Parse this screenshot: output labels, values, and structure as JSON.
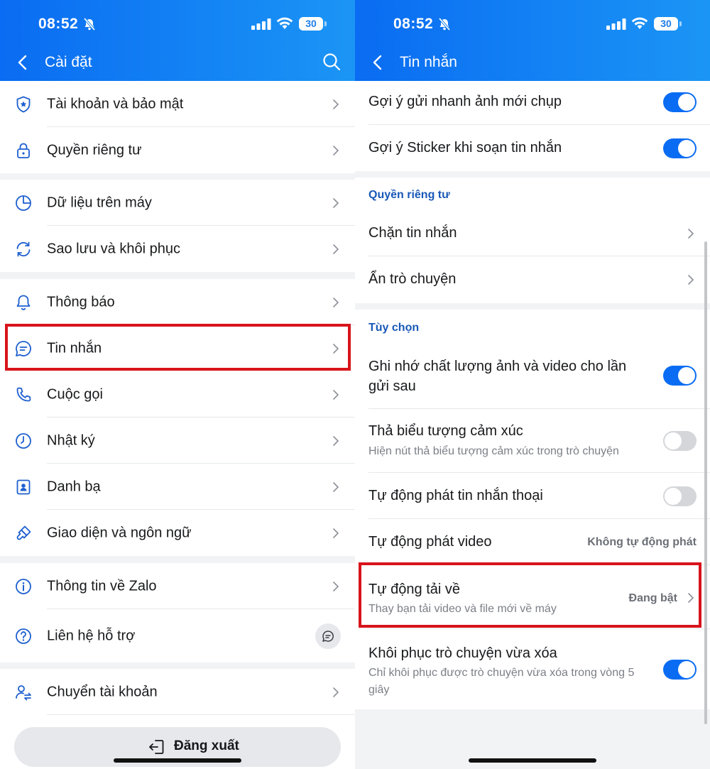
{
  "status": {
    "time": "08:52",
    "battery": "30"
  },
  "left": {
    "title": "Cài đặt",
    "groups": [
      [
        "Tài khoản và bảo mật",
        "Quyền riêng tư"
      ],
      [
        "Dữ liệu trên máy",
        "Sao lưu và khôi phục"
      ],
      [
        "Thông báo",
        "Tin nhắn",
        "Cuộc gọi",
        "Nhật ký",
        "Danh bạ",
        "Giao diện và ngôn ngữ"
      ],
      [
        "Thông tin về Zalo",
        "Liên hệ hỗ trợ"
      ],
      [
        "Chuyển tài khoản"
      ]
    ],
    "logout": "Đăng xuất"
  },
  "right": {
    "title": "Tin nhắn",
    "top_items": [
      {
        "label": "Gợi ý gửi nhanh ảnh mới chụp",
        "toggle": true
      },
      {
        "label": "Gợi ý Sticker khi soạn tin nhắn",
        "toggle": true
      }
    ],
    "privacy": {
      "title": "Quyền riêng tư",
      "items": [
        "Chặn tin nhắn",
        "Ẩn trò chuyện"
      ]
    },
    "options": {
      "title": "Tùy chọn",
      "items": [
        {
          "label": "Ghi nhớ chất lượng ảnh và video cho lần gửi sau",
          "toggle": true
        },
        {
          "label": "Thả biểu tượng cảm xúc",
          "sub": "Hiện nút thả biểu tượng cảm xúc trong trò chuyện",
          "toggle": false
        },
        {
          "label": "Tự động phát tin nhắn thoại",
          "toggle": false
        },
        {
          "label": "Tự động phát video",
          "value": "Không tự động phát"
        },
        {
          "label": "Tự động tải về",
          "sub": "Thay bạn tải video và file mới về máy",
          "value": "Đang bật"
        },
        {
          "label": "Khôi phục trò chuyện vừa xóa",
          "sub": "Chỉ khôi phục được trò chuyện vừa xóa trong vòng 5 giây",
          "toggle": true
        }
      ]
    }
  },
  "colors": {
    "accent": "#0a6cf2",
    "highlight": "#d8141b"
  },
  "icons": [
    "shield-icon",
    "lock-icon",
    "pie-chart-icon",
    "sync-icon",
    "bell-icon",
    "chat-icon",
    "phone-icon",
    "clock-icon",
    "contacts-icon",
    "brush-icon",
    "info-icon",
    "help-icon",
    "switch-account-icon"
  ]
}
